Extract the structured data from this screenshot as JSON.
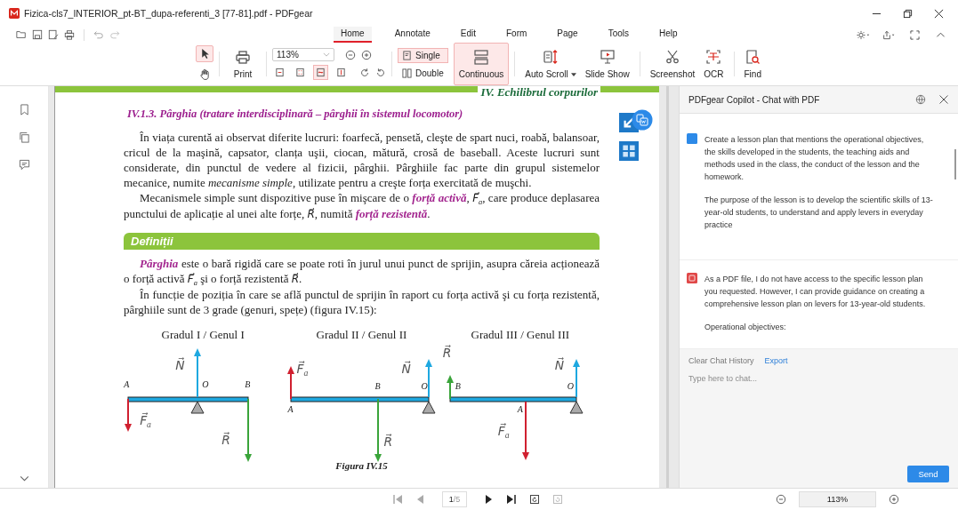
{
  "window": {
    "title": "Fizica-cls7_INTERIOR_pt-BT_dupa-referenti_3 [77-81].pdf - PDFgear"
  },
  "menu_tabs": [
    {
      "label": "Home",
      "selected": true
    },
    {
      "label": "Annotate",
      "selected": false
    },
    {
      "label": "Edit",
      "selected": false
    },
    {
      "label": "Form",
      "selected": false
    },
    {
      "label": "Page",
      "selected": false
    },
    {
      "label": "Tools",
      "selected": false
    },
    {
      "label": "Help",
      "selected": false
    }
  ],
  "toolbar": {
    "pointer_tools": [
      {
        "kind": "select",
        "selected": true
      },
      {
        "kind": "hand",
        "selected": false
      }
    ],
    "print": "Print",
    "zoom": "113%",
    "fit_modes": [
      {
        "kind": "actual",
        "selected": false
      },
      {
        "kind": "fit-page",
        "selected": false
      },
      {
        "kind": "fit-width",
        "selected": true
      },
      {
        "kind": "fit-height",
        "selected": false
      }
    ],
    "layouts": [
      {
        "label": "Single",
        "selected": true
      },
      {
        "label": "Double",
        "selected": false
      }
    ],
    "continuous": {
      "label": "Continuous",
      "selected": true
    },
    "tools": [
      {
        "kind": "auto-scroll",
        "label": "Auto Scroll",
        "dropdown": true
      },
      {
        "kind": "slide-show",
        "label": "Slide Show",
        "dropdown": false
      },
      {
        "kind": "screenshot",
        "label": "Screenshot",
        "dropdown": false
      },
      {
        "kind": "ocr",
        "label": "OCR",
        "dropdown": false
      },
      {
        "kind": "find",
        "label": "Find",
        "dropdown": false
      }
    ]
  },
  "document": {
    "chapter": "IV. Echilibrul corpurilor",
    "section": "IV.1.3. Pârghia (tratare interdisciplinară – pârghii în sistemul locomotor)",
    "paragraphs": [
      "În viața curentă ai observat diferite lucruri: foarfecă, pensetă, cleşte de spart nuci, roabă, balansoar, cricul de la maşină, capsator, clanța uşii, ciocan, mătură, crosă de baseball. Aceste lucruri sunt considerate, din punctul de vedere al fizicii, pârghii. Pârghiile fac parte din grupul sistemelor mecanice, numite *mecanisme simple*, utilizate pentru a creşte forța exercitată de muşchi.",
      "Mecanismele simple sunt dispozitive puse în mişcare de o **forță activă**, F⃗$_{a}$, care produce deplasarea punctului de aplicație al unei alte forțe, R⃗, numită **forță rezistentă**."
    ],
    "box_title": "Definiții",
    "definitions": [
      "**Pârghia** este o bară rigidă care se poate roti în jurul unui punct de sprijin, asupra căreia acționează o forță activă F⃗$_{a}$ şi o forță rezistentă R⃗.",
      "În funcție de poziția în care se află punctul de sprijin în raport cu forța activă şi cu forța rezistentă, pârghiile sunt de 3 grade (genuri, spețe) (figura IV.15):"
    ],
    "figures": [
      {
        "kind": "first",
        "title": "Gradul I / Genul I",
        "labels": {
          "a": "A",
          "o": "O",
          "b": "B",
          "n": "N⃗",
          "fa": "F⃗$_{a}$",
          "r": "R⃗"
        }
      },
      {
        "kind": "second",
        "title": "Gradul II / Genul II",
        "labels": {
          "a": "A",
          "o": "O",
          "b": "B",
          "n": "N⃗",
          "fa": "F⃗$_{a}$",
          "r": "R⃗"
        }
      },
      {
        "kind": "third",
        "title": "Gradul III / Genul III",
        "labels": {
          "a": "A",
          "o": "O",
          "b": "B",
          "n": "N⃗",
          "fa": "F⃗$_{a}$",
          "r": "R⃗"
        }
      }
    ],
    "caption": "Figura IV.15"
  },
  "chat": {
    "title": "PDFgear Copilot - Chat with PDF",
    "messages": [
      {
        "kind": "user",
        "paragraphs": [
          "Create a lesson plan that mentions the operational objectives, the skills developed in the students, the teaching aids and methods used in the class, the conduct of the lesson and the homework.",
          "The purpose of the lesson is to develop the scientific skills of 13-year-old students, to understand and apply levers in everyday practice"
        ]
      },
      {
        "kind": "assistant",
        "paragraphs": [
          "As a PDF file, I do not have access to the specific lesson plan you requested. However, I can provide guidance on creating a comprehensive lesson plan on levers for 13-year-old students.",
          "Operational objectives:"
        ]
      }
    ],
    "clear_label": "Clear Chat History",
    "export_label": "Export",
    "input_placeholder": "Type here to chat...",
    "send": "Send"
  },
  "footer": {
    "page_current": "1",
    "page_total": "/5",
    "zoom": "113%"
  }
}
